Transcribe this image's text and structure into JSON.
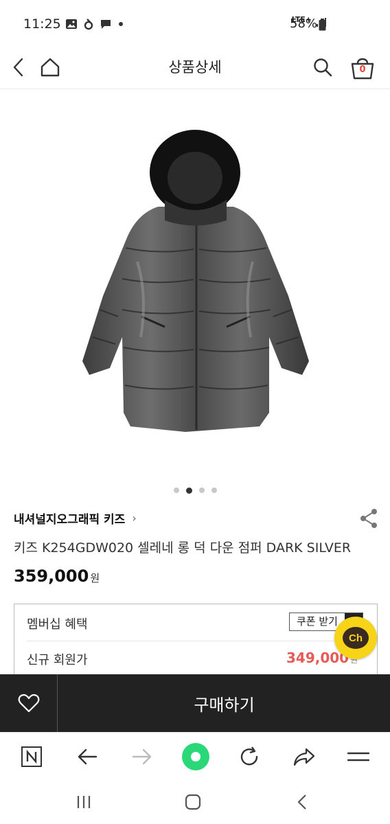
{
  "status_bar": {
    "time": "11:25",
    "network": "LTE+",
    "battery": "58%"
  },
  "header": {
    "title": "상품상세",
    "cart_count": "0"
  },
  "carousel": {
    "total": 4,
    "active_index": 1
  },
  "product": {
    "brand": "내셔널지오그래픽 키즈",
    "brand_chevron": "›",
    "title": "키즈 K254GDW020 셀레네 롱 덕 다운 점퍼 DARK SILVER",
    "price": "359,000",
    "price_unit": "원"
  },
  "membership": {
    "title": "멤버십 혜택",
    "coupon_label": "쿠폰 받기",
    "new_member_label": "신규 회원가",
    "new_member_price": "349,000",
    "new_member_unit": "원"
  },
  "chat": {
    "label": "Ch",
    "color": "#f7d417"
  },
  "buy_bar": {
    "buy_label": "구매하기"
  },
  "icons": {
    "back": "back-icon",
    "home": "home-icon",
    "search": "search-icon",
    "cart": "cart-icon",
    "share": "share-icon",
    "heart": "heart-icon",
    "naver": "naver-n-icon",
    "refresh": "refresh-icon",
    "menu": "menu-icon"
  },
  "colors": {
    "sale_price": "#e85a55",
    "cart_badge": "#e8473a",
    "buy_bar": "#222222",
    "browser_green": "#2bd878"
  }
}
